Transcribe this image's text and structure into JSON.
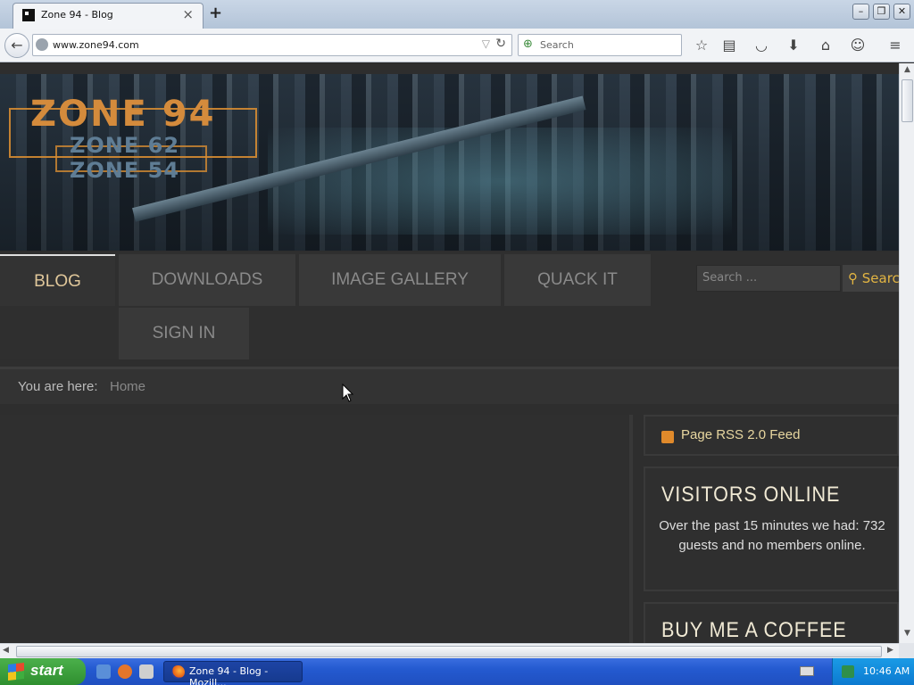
{
  "browser": {
    "tab_title": "Zone 94 - Blog",
    "tab_close": "×",
    "new_tab": "+",
    "url": "www.zone94.com",
    "search_placeholder": "Search",
    "window_controls": {
      "minimize": "–",
      "maximize": "❐",
      "close": "✕"
    }
  },
  "banner": {
    "logo_main": "ZONE 94",
    "logo_sub1": "ZONE 62",
    "logo_sub2": "ZONE 54"
  },
  "menu": {
    "items": [
      {
        "label": "BLOG",
        "active": true
      },
      {
        "label": "DOWNLOADS"
      },
      {
        "label": "IMAGE GALLERY"
      },
      {
        "label": "QUACK IT"
      },
      {
        "label": "SIGN IN"
      }
    ],
    "search_placeholder": "Search ...",
    "search_button": "Search"
  },
  "breadcrumb": {
    "label": "You are here:",
    "home": "Home"
  },
  "sidebar": {
    "rss_label": "Page RSS 2.0 Feed",
    "visitors_title": "VISITORS ONLINE",
    "visitors_text": "Over the past 15 minutes we had: 732 guests and no members online.",
    "coffee_title": "BUY ME A COFFEE"
  },
  "taskbar": {
    "start_label": "start",
    "task_label": "Zone 94 - Blog - Mozill...",
    "time": "10:46 AM"
  },
  "colors": {
    "accent_gold": "#e3b542",
    "logo_orange": "#d48b3c",
    "page_bg": "#2e2e2e"
  }
}
